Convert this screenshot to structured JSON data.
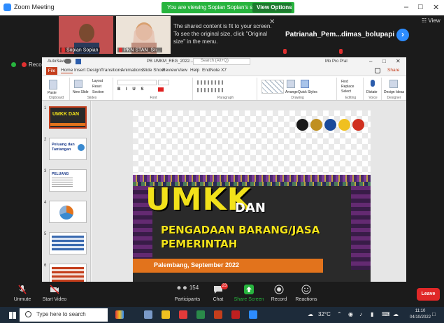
{
  "zoom": {
    "window_title": "Zoom Meeting",
    "share_banner": "You are viewing Sopian Sopian's screen",
    "view_options": "View Options ⌄",
    "view_label": "☷ View",
    "tooltip": "The shared content is fit to your screen. To see the original size, click \"Original size\" in the menu.",
    "recording_label": "Recordi",
    "participants": [
      {
        "name": "Sopian Sopian"
      },
      {
        "name": "PKN STAN_Sri..."
      },
      {
        "name": "Patrianah_Pem..."
      },
      {
        "name": "dimas_bolupapi"
      }
    ],
    "icons": {
      "next": "chevron-right-icon"
    }
  },
  "ppt": {
    "title_text": "PB UMKM_REG_2022...",
    "search_placeholder": "Search (Alt+Q)",
    "user_name": "Mo Pro Pral",
    "menu": [
      "File",
      "Home",
      "Insert",
      "Design",
      "Transitions",
      "Animations",
      "Slide Show",
      "Review",
      "View",
      "Help",
      "EndNote X7"
    ],
    "share_label": "Share",
    "ribbon_groups": [
      "Clipboard",
      "Slides",
      "Font",
      "Paragraph",
      "Drawing",
      "Editing",
      "Voice",
      "Designer"
    ],
    "ribbon_buttons": {
      "paste": "Paste",
      "new_slide": "New Slide",
      "reuse": "Reuse Slides",
      "layout": "Layout",
      "reset": "Reset",
      "section": "Section",
      "arrange": "Arrange",
      "quick_styles": "Quick Styles",
      "find": "Find",
      "replace": "Replace",
      "select": "Select",
      "dictate": "Dictate",
      "design_ideas": "Design Ideas"
    },
    "thumbnails": [
      {
        "num": "1",
        "text": "UMKK DAN"
      },
      {
        "num": "2",
        "text": "Peluang dan Tantangan"
      },
      {
        "num": "3",
        "text": "PELUANG"
      },
      {
        "num": "4",
        "text": ""
      },
      {
        "num": "5",
        "text": ""
      },
      {
        "num": "6",
        "text": ""
      }
    ]
  },
  "slide": {
    "title_main": "UMKK",
    "title_connector": "DAN",
    "subtitle_line1": "PENGADAAN BARANG/JASA",
    "subtitle_line2": "PEMERINTAH",
    "city_date": "Palembang, September 2022",
    "logo_colors": [
      "#1a1a1a",
      "#c09020",
      "#1a4a9a",
      "#f0c020",
      "#d03020"
    ]
  },
  "toolbar": {
    "unmute": "Unmute",
    "start_video": "Start Video",
    "participants": "Participants",
    "participants_count": "154",
    "chat": "Chat",
    "chat_badge": "23",
    "share_screen": "Share Screen",
    "record": "Record",
    "reactions": "Reactions",
    "leave": "Leave"
  },
  "taskbar": {
    "search_placeholder": "Type here to search",
    "temperature": "32°C",
    "time": "11:10",
    "date": "04/10/2022"
  }
}
